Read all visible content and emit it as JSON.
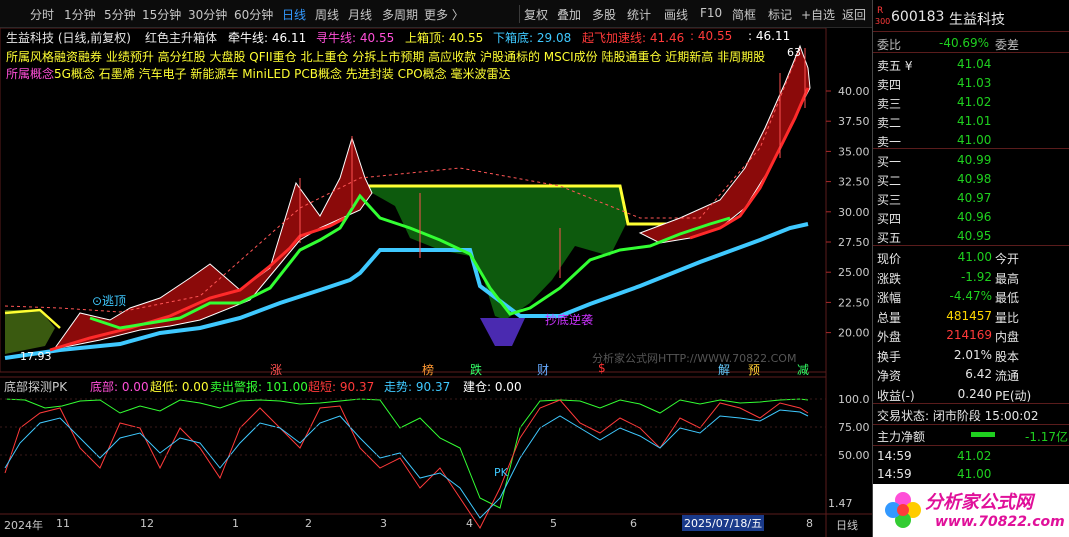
{
  "toolbar": {
    "periods": [
      "分时",
      "1分钟",
      "5分钟",
      "15分钟",
      "30分钟",
      "60分钟",
      "日线",
      "周线",
      "月线",
      "多周期",
      "更多 〉"
    ],
    "active_period": "日线",
    "actions": [
      "复权",
      "叠加",
      "多股",
      "统计",
      "画线",
      "F10",
      "简框",
      "标记",
      "+自选",
      "返回"
    ]
  },
  "main_legend": {
    "stock": "生益科技 (日线,前复权)",
    "indicator": "红色主升箱体",
    "items": [
      {
        "label": "牵牛线: 46.11",
        "color": "#ffffff"
      },
      {
        "label": "寻牛线: 40.55",
        "color": "#ff4fd8"
      },
      {
        "label": "上箱顶: 40.55",
        "color": "#ffff33"
      },
      {
        "label": "下箱底: 29.08",
        "color": "#3fc9ff"
      },
      {
        "label": "起飞加速线: 41.46",
        "color": "#ff3a3a"
      },
      {
        "label": ": 40.55",
        "color": "#ff3a3a"
      },
      {
        "label": ": 46.11",
        "color": "#ffffff"
      }
    ],
    "style_label": "所属风格",
    "style_values": "融资融券 业绩预升 高分红股 大盘股 QFII重仓 北上重仓 分拆上市预期 高应收款 沪股通标的 MSCI成份 陆股通重仓 近期新高 非周期股",
    "concept_label": "所属概念",
    "concept_values": "5G概念 石墨烯 汽车电子 新能源车 MiniLED PCB概念 先进封装 CPO概念 毫米波雷达"
  },
  "main_axis": {
    "ticks": [
      "40.00",
      "37.50",
      "35.00",
      "32.50",
      "30.00",
      "27.50",
      "25.00",
      "22.50",
      "20.00"
    ]
  },
  "annotations": {
    "escape_top": "⊙逃顶",
    "bottom_copy": "抄底逆袭",
    "low_price": "17.93",
    "high_price": "63",
    "watermark": "分析家公式网HTTP://WWW.70822.COM",
    "pk_label": "PK",
    "event_marks": [
      {
        "text": "涨",
        "color": "#ff5050"
      },
      {
        "text": "榜",
        "color": "#ff9933"
      },
      {
        "text": "跌",
        "color": "#33ff66"
      },
      {
        "text": "财",
        "color": "#66aaff"
      },
      {
        "text": "$",
        "color": "#ff3333"
      },
      {
        "text": "解",
        "color": "#66ccff"
      },
      {
        "text": "预",
        "color": "#ffcc33"
      },
      {
        "text": "减",
        "color": "#33ff66"
      }
    ]
  },
  "sub_legend": {
    "name": "底部探测PK",
    "items": [
      {
        "label": "底部: 0.00",
        "color": "#ff4fd8"
      },
      {
        "label": "超低: 0.00",
        "color": "#ffff33"
      },
      {
        "label": "卖出警报: 101.00",
        "color": "#33ff33"
      },
      {
        "label": "超短: 90.37",
        "color": "#ff3a3a"
      },
      {
        "label": "走势: 90.37",
        "color": "#3fc9ff"
      },
      {
        "label": "建仓: 0.00",
        "color": "#ffffff"
      }
    ]
  },
  "sub_axis": {
    "ticks": [
      "100.0",
      "75.00",
      "50.00"
    ],
    "current": "1.47"
  },
  "time_axis": {
    "labels": [
      "2024年",
      "11",
      "12",
      "1",
      "2",
      "3",
      "4",
      "5",
      "6"
    ],
    "cursor_date": "2025/07/18/五",
    "last": "8",
    "period_btn": "日线"
  },
  "quote": {
    "code": "600183",
    "name": "生益科技",
    "badge_top": "R",
    "badge_bottom": "300",
    "weibi_label": "委比",
    "weibi_value": "-40.69%",
    "weicha_label": "委差",
    "asks": [
      {
        "label": "卖五 ¥",
        "price": "41.04"
      },
      {
        "label": "卖四",
        "price": "41.03"
      },
      {
        "label": "卖三",
        "price": "41.02"
      },
      {
        "label": "卖二",
        "price": "41.01"
      },
      {
        "label": "卖一",
        "price": "41.00"
      }
    ],
    "bids": [
      {
        "label": "买一",
        "price": "40.99"
      },
      {
        "label": "买二",
        "price": "40.98"
      },
      {
        "label": "买三",
        "price": "40.97"
      },
      {
        "label": "买四",
        "price": "40.96"
      },
      {
        "label": "买五",
        "price": "40.95"
      }
    ],
    "stats": [
      {
        "l1": "现价",
        "v1": "41.00",
        "c1": "green",
        "l2": "今开",
        "v2": "",
        "c2": "green"
      },
      {
        "l1": "涨跌",
        "v1": "-1.92",
        "c1": "green",
        "l2": "最高",
        "v2": "",
        "c2": "green"
      },
      {
        "l1": "涨幅",
        "v1": "-4.47%",
        "c1": "green",
        "l2": "最低",
        "v2": "",
        "c2": "green"
      },
      {
        "l1": "总量",
        "v1": "481457",
        "c1": "yellow",
        "l2": "量比",
        "v2": "",
        "c2": "white"
      },
      {
        "l1": "外盘",
        "v1": "214169",
        "c1": "red",
        "l2": "内盘",
        "v2": "",
        "c2": "green"
      },
      {
        "l1": "换手",
        "v1": "2.01%",
        "c1": "white",
        "l2": "股本",
        "v2": "",
        "c2": "white"
      },
      {
        "l1": "净资",
        "v1": "6.42",
        "c1": "white",
        "l2": "流通",
        "v2": "",
        "c2": "white"
      },
      {
        "l1": "收益(-)",
        "v1": "0.240",
        "c1": "white",
        "l2": "PE(动)",
        "v2": "",
        "c2": "white"
      }
    ],
    "trade_status": "交易状态: 闭市阶段 15:00:02",
    "net_flow_label": "主力净额",
    "net_flow_value": "-1.17亿",
    "ticks": [
      {
        "time": "14:59",
        "price": "41.02"
      },
      {
        "time": "14:59",
        "price": "41.00"
      }
    ]
  },
  "logo": {
    "text": "分析家公式网",
    "url": "www.70822.com"
  }
}
